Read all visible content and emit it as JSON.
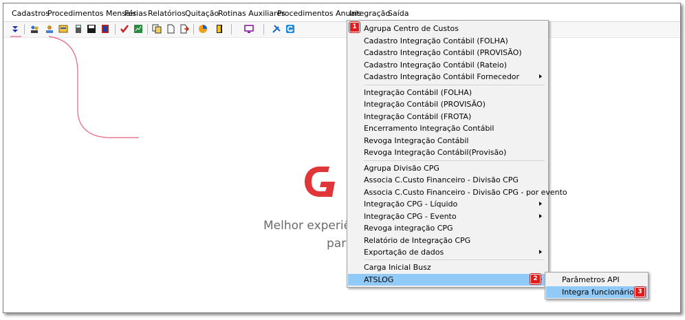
{
  "menubar": {
    "items": [
      "Cadastros",
      "Procedimentos Mensais",
      "Férias",
      "Relatórios",
      "Quitação",
      "Rotinas Auxiliares",
      "Procedimentos Anuais",
      "Integração",
      "Saída"
    ]
  },
  "toolbar": {
    "icons": [
      "down-arrow-icon",
      "people-icon",
      "users-icon",
      "form-icon",
      "calculator-icon",
      "save-icon",
      "film-icon",
      "checkmark-icon",
      "chart-icon",
      "copy-icon",
      "document-icon",
      "export-icon",
      "pie-chart-icon",
      "exit-door-icon",
      "monitor-icon",
      "tools-icon",
      "g-logo-icon"
    ]
  },
  "background": {
    "tagline_line1": "Melhor experiê",
    "tagline_line2": "para",
    "brand_color": "#e0363a"
  },
  "integration_menu": {
    "items": [
      {
        "label": "Agrupa Centro de Custos"
      },
      {
        "label": "Cadastro Integração Contábil (FOLHA)"
      },
      {
        "label": "Cadastro Integração Contábil (PROVISÃO)"
      },
      {
        "label": "Cadastro Integração Contábil (Rateio)"
      },
      {
        "label": "Cadastro Integração Contábil Fornecedor",
        "submenu": true
      },
      {
        "label": "Integração Contábil (FOLHA)"
      },
      {
        "label": "Integração Contábil (PROVISÃO)"
      },
      {
        "label": "Integração Contábil (FROTA)"
      },
      {
        "label": "Encerramento Integração Contábil"
      },
      {
        "label": "Revoga Integração Contábil"
      },
      {
        "label": "Revoga Integração Contábil(Provisão)"
      },
      {
        "label": "Agrupa Divisão CPG"
      },
      {
        "label": "Associa C.Custo Financeiro - Divisão CPG"
      },
      {
        "label": "Associa C.Custo Financeiro - Divisão CPG - por evento"
      },
      {
        "label": "Integração CPG - Líquido",
        "submenu": true
      },
      {
        "label": "Integração CPG - Evento",
        "submenu": true
      },
      {
        "label": "Revoga integração CPG"
      },
      {
        "label": "Relatório de Integração CPG"
      },
      {
        "label": "Exportação de dados",
        "submenu": true
      },
      {
        "label": "Carga Inicial Busz"
      },
      {
        "label": "ATSLOG",
        "submenu": true,
        "selected": true
      }
    ]
  },
  "atslog_submenu": {
    "items": [
      {
        "label": "Parâmetros API"
      },
      {
        "label": "Integra funcionários",
        "selected": true
      }
    ]
  },
  "callouts": [
    "1",
    "2",
    "3"
  ],
  "colors": {
    "highlight": "#91c9f7",
    "callout": "#e01b1b",
    "annotation_line": "#e8607a"
  }
}
